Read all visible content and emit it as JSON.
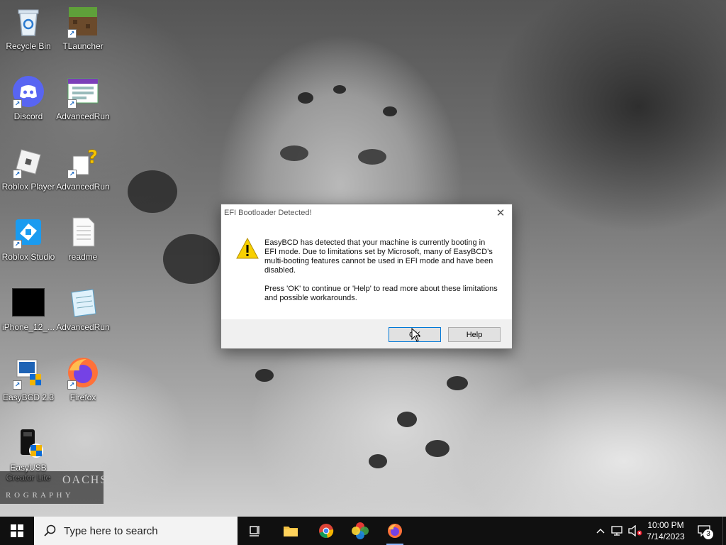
{
  "desktop_icons": [
    {
      "label": "Recycle Bin",
      "icon": "recycle-bin-icon"
    },
    {
      "label": "TLauncher",
      "icon": "tlauncher-icon"
    },
    {
      "label": "Discord",
      "icon": "discord-icon"
    },
    {
      "label": "AdvancedRun",
      "icon": "advancedrun-icon"
    },
    {
      "label": "Roblox Player",
      "icon": "roblox-player-icon"
    },
    {
      "label": "AdvancedRun",
      "icon": "advancedrun-help-icon"
    },
    {
      "label": "Roblox Studio",
      "icon": "roblox-studio-icon"
    },
    {
      "label": "readme",
      "icon": "text-file-icon"
    },
    {
      "label": "iPhone_12_...",
      "icon": "black-image-icon"
    },
    {
      "label": "AdvancedRun",
      "icon": "notepad-icon"
    },
    {
      "label": "EasyBCD 2.3",
      "icon": "easybcd-icon"
    },
    {
      "label": "Firefox",
      "icon": "firefox-icon"
    },
    {
      "label": "EasyUSB Creator Lite",
      "icon": "easyusb-icon"
    }
  ],
  "watermark": {
    "line1": "OACHS",
    "line2": "R O G R A P H Y"
  },
  "dialog": {
    "title": "EFI Bootloader Detected!",
    "close_glyph": "✕",
    "message_p1": "EasyBCD has detected that your machine is currently booting in EFI mode. Due to limitations set by Microsoft, many of EasyBCD's multi-booting features cannot be used in EFI mode and have been disabled.",
    "message_p2": "Press 'OK' to continue or 'Help' to read more about these limitations and possible workarounds.",
    "ok_label": "OK",
    "help_label": "Help",
    "icon": "warning-icon"
  },
  "taskbar": {
    "search_placeholder": "Type here to search",
    "apps": [
      "task-view-icon",
      "file-explorer-icon",
      "chrome-icon",
      "color-app-icon",
      "firefox-icon"
    ],
    "time": "10:00 PM",
    "date": "7/14/2023",
    "notification_count": "3",
    "accent": "#0078d7"
  }
}
